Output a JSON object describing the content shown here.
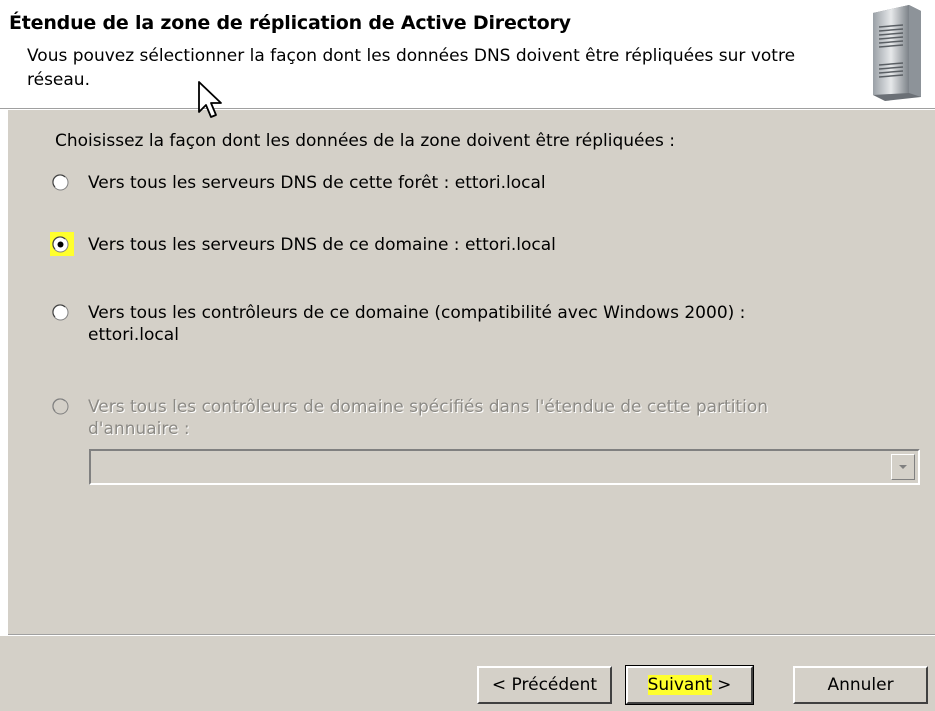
{
  "header": {
    "title": "Étendue de la zone de réplication de Active Directory",
    "subtitle": "Vous pouvez sélectionner la façon dont les données DNS doivent être répliquées sur votre réseau."
  },
  "body": {
    "prompt": "Choisissez la façon dont les données de la zone doivent être répliquées :",
    "options": [
      {
        "label": "Vers tous les serveurs DNS de cette forêt : ettori.local",
        "selected": false,
        "enabled": true
      },
      {
        "label": "Vers tous les serveurs DNS de ce domaine : ettori.local",
        "selected": true,
        "enabled": true
      },
      {
        "label_line1": "Vers tous les contrôleurs de ce domaine (compatibilité avec Windows 2000) :",
        "label_line2": "ettori.local",
        "selected": false,
        "enabled": true
      },
      {
        "label_line1": "Vers tous les contrôleurs de domaine spécifiés dans l'étendue de cette partition",
        "label_line2": "d'annuaire :",
        "selected": false,
        "enabled": false
      }
    ],
    "partition_select": {
      "value": ""
    }
  },
  "buttons": {
    "back": "< Précédent",
    "next_highlight": "Suivant",
    "next_suffix": " >",
    "cancel": "Annuler"
  },
  "colors": {
    "highlight": "#ffff2d",
    "dialog_bg": "#d4d0c8",
    "header_bg": "#ffffff"
  },
  "icons": {
    "header": "server-icon",
    "cursor": "mouse-pointer-icon"
  }
}
